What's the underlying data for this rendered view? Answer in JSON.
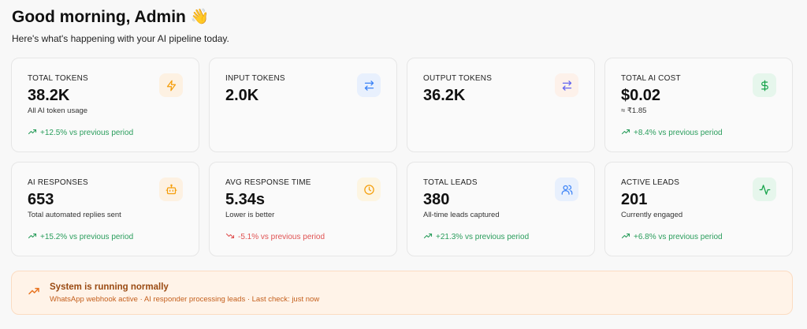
{
  "header": {
    "greeting": "Good morning, Admin",
    "emoji": "👋",
    "subtitle": "Here's what's happening with your AI pipeline today."
  },
  "cards": [
    {
      "label": "TOTAL TOKENS",
      "value": "38.2K",
      "sub": "All AI token usage",
      "trend": "+12.5% vs previous period",
      "trend_dir": "up",
      "icon": "bolt-icon",
      "icon_color": "#f59e0b",
      "icon_bg": "#fdf1e2"
    },
    {
      "label": "INPUT TOKENS",
      "value": "2.0K",
      "sub": "",
      "trend": "",
      "trend_dir": "",
      "icon": "arrows-exchange-icon",
      "icon_color": "#3b82f6",
      "icon_bg": "#e8f0fd"
    },
    {
      "label": "OUTPUT TOKENS",
      "value": "36.2K",
      "sub": "",
      "trend": "",
      "trend_dir": "",
      "icon": "arrows-exchange-icon",
      "icon_color": "#6366f1",
      "icon_bg": "#fdf1ea"
    },
    {
      "label": "TOTAL AI COST",
      "value": "$0.02",
      "sub": "≈ ₹1.85",
      "trend": "+8.4% vs previous period",
      "trend_dir": "up",
      "icon": "dollar-icon",
      "icon_color": "#16a34a",
      "icon_bg": "#e6f6ec"
    },
    {
      "label": "AI RESPONSES",
      "value": "653",
      "sub": "Total automated replies sent",
      "trend": "+15.2% vs previous period",
      "trend_dir": "up",
      "icon": "robot-icon",
      "icon_color": "#f59e0b",
      "icon_bg": "#fdf1e2"
    },
    {
      "label": "AVG RESPONSE TIME",
      "value": "5.34s",
      "sub": "Lower is better",
      "trend": "-5.1% vs previous period",
      "trend_dir": "down",
      "icon": "clock-icon",
      "icon_color": "#f59e0b",
      "icon_bg": "#fdf5e2"
    },
    {
      "label": "TOTAL LEADS",
      "value": "380",
      "sub": "All-time leads captured",
      "trend": "+21.3% vs previous period",
      "trend_dir": "up",
      "icon": "users-icon",
      "icon_color": "#3b82f6",
      "icon_bg": "#e8f0fd"
    },
    {
      "label": "ACTIVE LEADS",
      "value": "201",
      "sub": "Currently engaged",
      "trend": "+6.8% vs previous period",
      "trend_dir": "up",
      "icon": "activity-icon",
      "icon_color": "#16a34a",
      "icon_bg": "#e6f6ec"
    }
  ],
  "banner": {
    "title": "System is running normally",
    "detail": "WhatsApp webhook active · AI responder processing leads · Last check: just now",
    "icon": "trending-up-icon"
  }
}
